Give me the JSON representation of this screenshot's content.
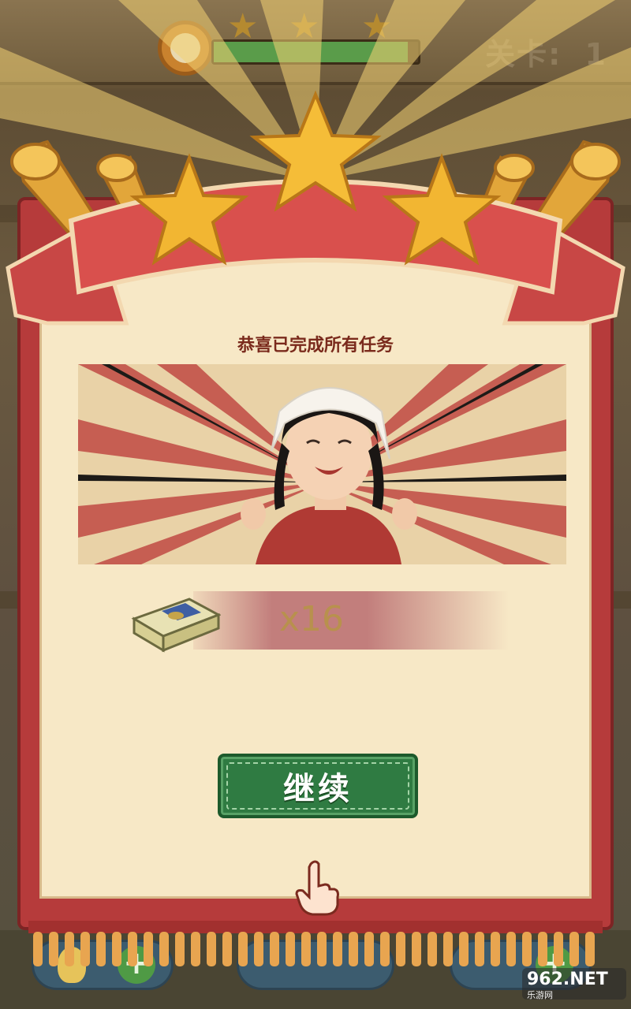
{
  "hud": {
    "level_label": "关卡:",
    "level_value": "1",
    "top_stars": 3,
    "timer_progress": 0.95
  },
  "result": {
    "stars_earned": 3,
    "subtitle": "恭喜已完成所有任务",
    "reward": {
      "icon": "cash-stack-icon",
      "count": "x16"
    },
    "continue_label": "继续"
  },
  "watermark": {
    "brand": "962.NET",
    "caption": "乐游网"
  },
  "colors": {
    "ribbon_red": "#d9504d",
    "panel_cream": "#f7e8c6",
    "button_green": "#2f7b42",
    "star_gold": "#f2b632"
  }
}
